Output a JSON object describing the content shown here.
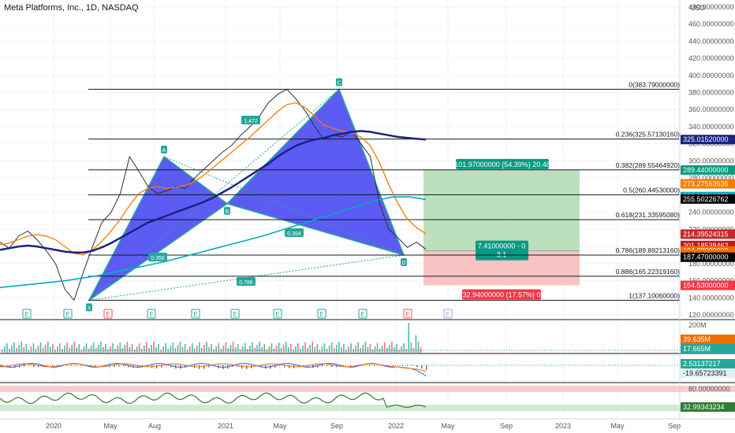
{
  "symbol_title": "Meta Platforms, Inc., 1D, NASDAQ",
  "currency": "USD",
  "chart_data": {
    "type": "line",
    "title": "Meta Platforms, Inc., 1D, NASDAQ",
    "y_unit": "USD",
    "ylim": [
      120,
      480
    ],
    "x_ticks": [
      "2020",
      "May",
      "Aug",
      "2021",
      "May",
      "Sep",
      "2022",
      "May",
      "Sep",
      "2023",
      "May",
      "Sep"
    ],
    "y_ticks": [
      "120.00000000",
      "140.00000000",
      "160.00000000",
      "180.00000000",
      "200.00000000",
      "220.00000000",
      "240.00000000",
      "260.00000000",
      "280.00000000",
      "300.00000000",
      "320.00000000",
      "340.00000000",
      "360.00000000",
      "380.00000000",
      "400.00000000",
      "420.00000000",
      "440.00000000",
      "460.00000000",
      "480.00000000"
    ],
    "series": [
      {
        "values": [
          205,
          198,
          212,
          218,
          208,
          195,
          180,
          150,
          137.1,
          170,
          200,
          228,
          240,
          262,
          305,
          288,
          270,
          262,
          265,
          270,
          268,
          280,
          290,
          300,
          310,
          318,
          330,
          340,
          352,
          368,
          378,
          383.79,
          372,
          358,
          340,
          325,
          330,
          328,
          335,
          320,
          305,
          250,
          220,
          210,
          199,
          205,
          196.64
        ]
      },
      {
        "values": [
          202,
          204,
          208,
          212,
          214,
          212,
          208,
          200,
          192,
          190,
          196,
          206,
          218,
          232,
          248,
          262,
          268,
          270,
          268,
          269,
          271,
          276,
          283,
          292,
          301,
          310,
          319,
          328,
          338,
          348,
          358,
          366,
          368,
          362,
          352,
          342,
          338,
          335,
          333,
          328,
          318,
          298,
          272,
          250,
          232,
          222,
          215
        ]
      },
      {
        "values": [
          196,
          198,
          200,
          201,
          200,
          198,
          196,
          194,
          193,
          193,
          195,
          199,
          204,
          210,
          216,
          222,
          228,
          232,
          236,
          240,
          244,
          248,
          252,
          257,
          263,
          269,
          276,
          283,
          290,
          297,
          305,
          312,
          318,
          322,
          325,
          327,
          330,
          332,
          334,
          335,
          334,
          332,
          330,
          328,
          327,
          326,
          325.0
        ]
      }
    ],
    "harmonic_pattern": {
      "points": [
        {
          "label": "X",
          "value": 137.1
        },
        {
          "label": "A",
          "value": 305
        },
        {
          "label": "B",
          "value": 250
        },
        {
          "label": "C",
          "value": 383.79
        },
        {
          "label": "D",
          "value": 190
        }
      ],
      "ratios": [
        "1.472",
        "0.356",
        "0.394",
        "0.786"
      ]
    },
    "fib_levels": [
      {
        "ratio": "0",
        "text": "0(383.79000000)",
        "value": 383.79
      },
      {
        "ratio": "0.236",
        "text": "0.236(325.57130160)",
        "value": 325.5713016
      },
      {
        "ratio": "0.382",
        "text": "0.382(289.55464920)",
        "value": 289.5546492
      },
      {
        "ratio": "0.5",
        "text": "0.5(260.44530000)",
        "value": 260.4453
      },
      {
        "ratio": "0.618",
        "text": "0.618(231.33595080)",
        "value": 231.3359508
      },
      {
        "ratio": "0.786",
        "text": "0.786(189.89213160)",
        "value": 189.8921316
      },
      {
        "ratio": "0.886",
        "text": "0.886(165.22319160)",
        "value": 165.2231916
      },
      {
        "ratio": "1",
        "text": "1(137.10060000)",
        "value": 137.1006
      }
    ],
    "position_tool": {
      "entry": 194.88,
      "target": 289.44,
      "stop": 154.53,
      "target_text": "101.97000000 (54.39%) 20.48",
      "stop_text": "32.94000000 (17.57%) 0",
      "center_text_1": "7.41000000 - 0",
      "center_text_2": "3.1"
    },
    "price_labels": [
      {
        "text": "325.01520000",
        "value": 325.0152,
        "color": "#1a237e"
      },
      {
        "text": "289.44000000",
        "value": 289.44,
        "color": "#089981"
      },
      {
        "text": "273.27563636",
        "value": 273.27563636,
        "color": "#f57c00"
      },
      {
        "text": "258.38746279",
        "value": 258.38746279,
        "color": "#00acc1"
      },
      {
        "text": "255.50226762",
        "value": 255.50226762,
        "color": "#000000"
      },
      {
        "text": "214.39524315",
        "value": 214.39524315,
        "color": "#c62828"
      },
      {
        "text": "201.18538462",
        "value": 201.18538462,
        "color": "#b71c1c"
      },
      {
        "text": "194.88000000",
        "value": 194.88,
        "color": "#ef6c00"
      },
      {
        "text": "01:06:18",
        "value": 190.5,
        "color": "#ef6c00"
      },
      {
        "text": "187.47000000",
        "value": 187.47,
        "color": "#000000"
      },
      {
        "text": "154.53000000",
        "value": 154.53,
        "color": "#f23645"
      }
    ],
    "events": [
      "E",
      "E",
      "E",
      "E",
      "E",
      "E",
      "E",
      "E",
      "E",
      "E",
      "E"
    ],
    "volume_pane": {
      "tick": "200M",
      "labels": [
        {
          "text": "39.635M",
          "color": "#ef6c00"
        },
        {
          "text": "17.665M",
          "color": "#26a69a"
        }
      ]
    },
    "macd_pane": {
      "labels": [
        {
          "text": "2.53137217",
          "color": "#26a69a"
        },
        {
          "text": "-19.65723391",
          "color": "#ffffff"
        }
      ]
    },
    "rsi_pane": {
      "tick": "80.00000000",
      "labels": [
        {
          "text": "32.99343234",
          "color": "#2e7d32"
        }
      ]
    }
  }
}
